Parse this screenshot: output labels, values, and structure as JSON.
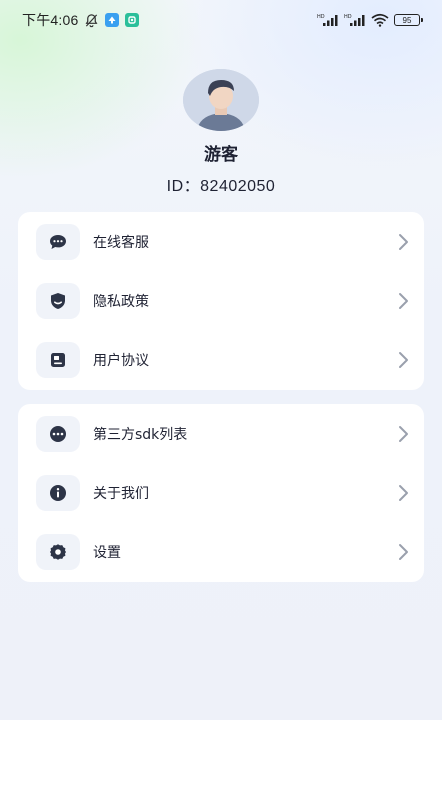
{
  "status_bar": {
    "time": "下午4:06",
    "battery": "95"
  },
  "profile": {
    "name": "游客",
    "id_text": "ID：82402050"
  },
  "menu_group_1": [
    {
      "label": "在线客服",
      "icon": "chat-icon"
    },
    {
      "label": "隐私政策",
      "icon": "shield-icon"
    },
    {
      "label": "用户协议",
      "icon": "document-icon"
    }
  ],
  "menu_group_2": [
    {
      "label": "第三方sdk列表",
      "icon": "more-dots-icon"
    },
    {
      "label": "关于我们",
      "icon": "info-icon"
    },
    {
      "label": "设置",
      "icon": "gear-icon"
    }
  ],
  "colors": {
    "icon": "#2d3447",
    "chevron": "#9aa0ad",
    "card": "#ffffff",
    "background": "#eef2fa"
  }
}
